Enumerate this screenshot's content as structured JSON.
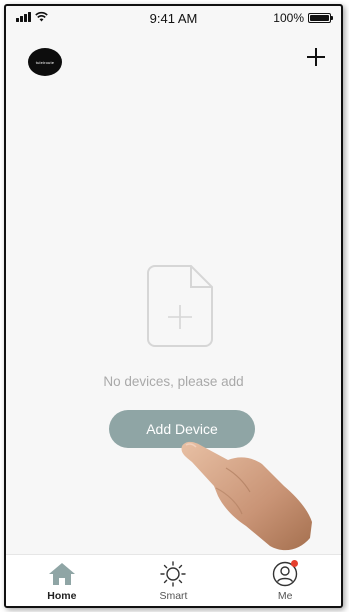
{
  "status_bar": {
    "time": "9:41 AM",
    "battery_percent": "100%",
    "battery_level": 1.0
  },
  "header": {
    "logo_text": "tuleiroute",
    "add_icon": "plus-icon"
  },
  "empty_state": {
    "illustration_icon": "file-add-icon",
    "message": "No devices, please add",
    "button_label": "Add Device"
  },
  "tab_bar": {
    "items": [
      {
        "label": "Home",
        "icon": "home-icon",
        "active": true
      },
      {
        "label": "Smart",
        "icon": "sun-icon",
        "active": false
      },
      {
        "label": "Me",
        "icon": "user-icon",
        "active": false,
        "badge": true
      }
    ]
  },
  "colors": {
    "button": "#8fa5a5",
    "badge": "#e4402e",
    "home_icon": "#8fa5a5"
  }
}
